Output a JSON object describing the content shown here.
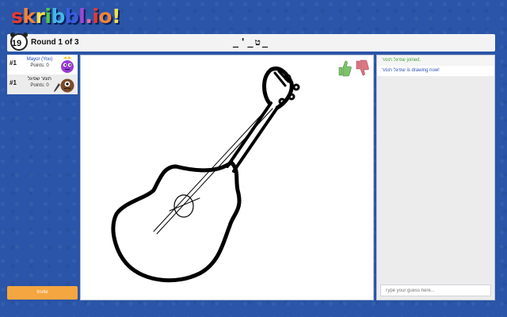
{
  "logo": {
    "letters": [
      "s",
      "k",
      "r",
      "i",
      "b",
      "b",
      "l",
      ".",
      "i",
      "o",
      "!"
    ],
    "colors": [
      "#e63a2e",
      "#f0823a",
      "#f6e04b",
      "#55c745",
      "#44b6e8",
      "#3a5ce1",
      "#a246d6",
      "#f06aa7",
      "#e63a2e",
      "#f0823a",
      "#f6e04b"
    ]
  },
  "header": {
    "timer": "19",
    "round": "Round 1 of 3",
    "word_hint": "_ט_'_"
  },
  "players": [
    {
      "rank": "#1",
      "name": "Mayor (You)",
      "points": "Points: 0",
      "avatar_color": "#9b3bd9"
    },
    {
      "rank": "#1",
      "name": "תומר שפיגל",
      "points": "Points: 0",
      "avatar_color": "#7a4a2a"
    }
  ],
  "invite_label": "Invite",
  "chat": {
    "messages": [
      {
        "text": "שפיגל תומר joined.",
        "type": "joined"
      },
      {
        "text": "שפיגל תומר is drawing now!",
        "type": "drawing"
      }
    ],
    "placeholder": "Type your guess here..."
  },
  "colors": {
    "background": "#2a55a8",
    "invite": "#f4a640",
    "like": "#7cc36a",
    "dislike": "#e07582"
  }
}
